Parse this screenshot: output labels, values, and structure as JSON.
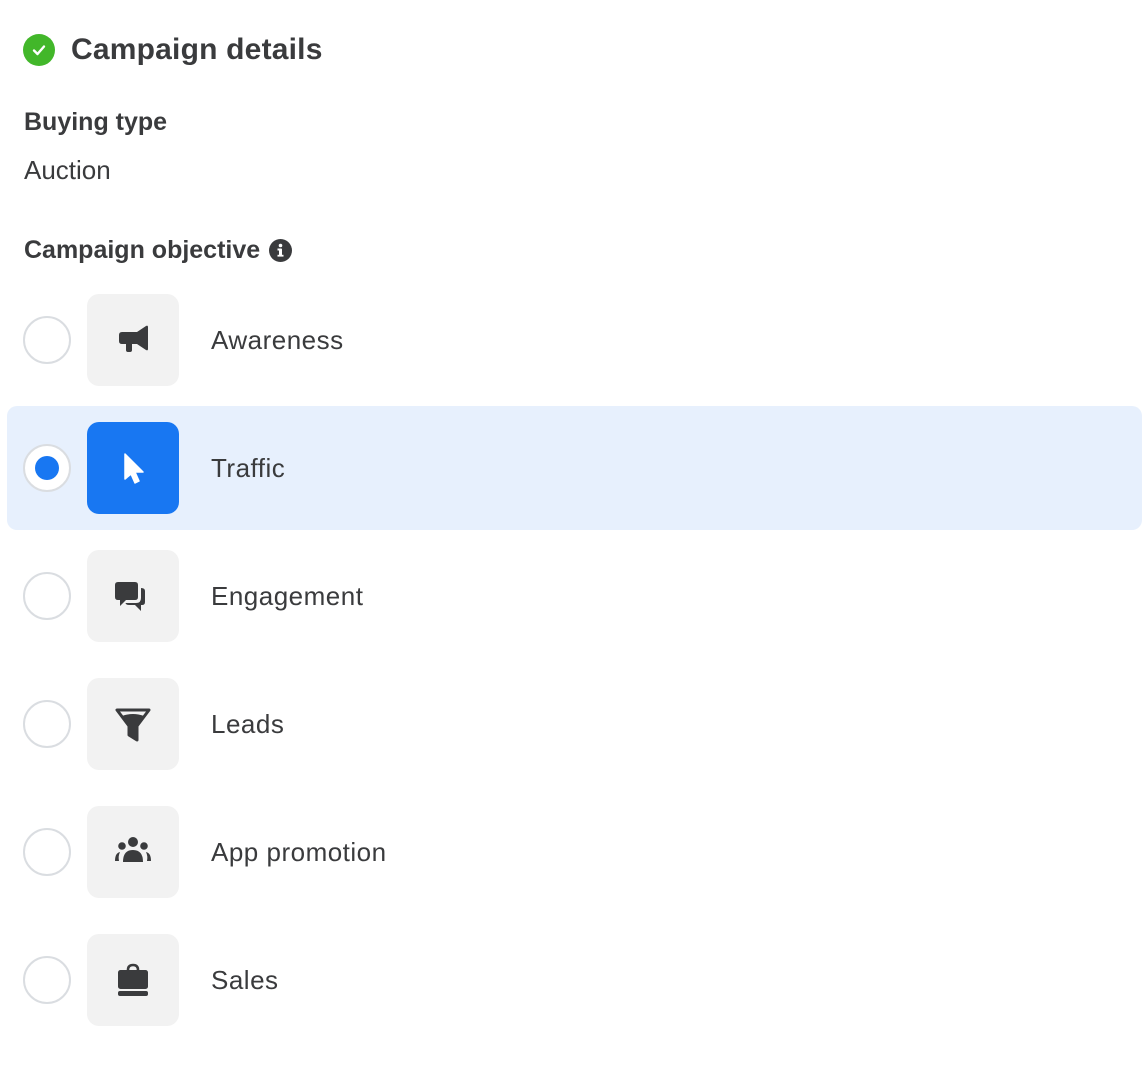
{
  "header": {
    "title": "Campaign details",
    "status_icon": "check-circle-icon",
    "status_color": "#42b72a"
  },
  "buying_type": {
    "label": "Buying type",
    "value": "Auction"
  },
  "objective": {
    "label": "Campaign objective",
    "info_icon": "info-icon",
    "selected": "Traffic",
    "accent_color": "#1877f2",
    "selected_row_color": "#e7f0fd",
    "options": [
      {
        "label": "Awareness",
        "icon": "megaphone-icon",
        "selected": false
      },
      {
        "label": "Traffic",
        "icon": "cursor-icon",
        "selected": true
      },
      {
        "label": "Engagement",
        "icon": "chat-bubbles-icon",
        "selected": false
      },
      {
        "label": "Leads",
        "icon": "funnel-icon",
        "selected": false
      },
      {
        "label": "App promotion",
        "icon": "people-icon",
        "selected": false
      },
      {
        "label": "Sales",
        "icon": "shopping-bag-icon",
        "selected": false
      }
    ]
  }
}
